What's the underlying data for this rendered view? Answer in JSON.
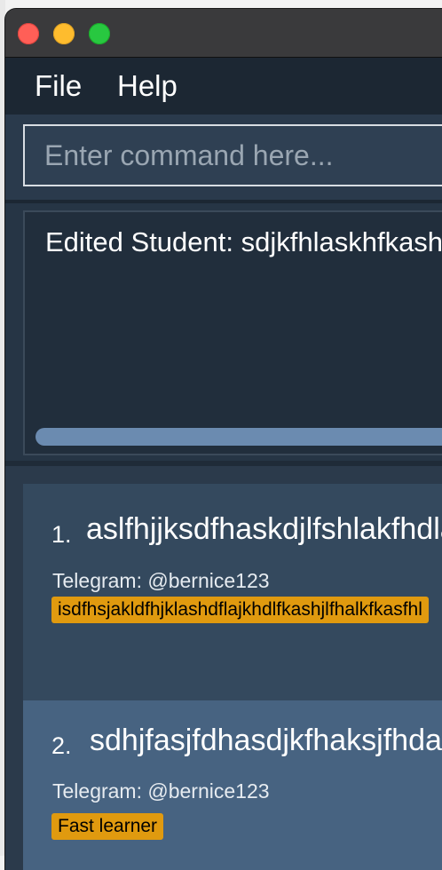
{
  "menu": {
    "file": "File",
    "help": "Help"
  },
  "command": {
    "placeholder": "Enter command here...",
    "value": ""
  },
  "result": {
    "text": "Edited Student: sdjkfhlaskhfkashdfkjlashf"
  },
  "students": [
    {
      "index": "1.",
      "name": "aslfhjjksdfhaskdjlfshlakfhdlaksjf",
      "telegram": "Telegram: @bernice123",
      "tags": [
        "isdfhsjakldfhjklashdflajkhdlfkashjlfhalkfkasfhl"
      ]
    },
    {
      "index": "2.",
      "name": "sdhjfasjfdhasdjkfhaksjfhdaksf",
      "telegram": "Telegram: @bernice123",
      "tags": [
        "Fast learner"
      ]
    }
  ],
  "colors": {
    "tag": "#e09a0f",
    "card_odd": "#34495e",
    "card_even": "#476381",
    "scrollbar": "#6b8bb0"
  }
}
